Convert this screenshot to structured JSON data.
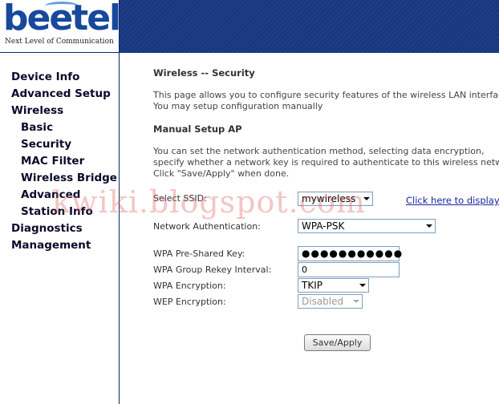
{
  "brand": {
    "logo_text": "beetel",
    "tagline": "Next Level of Communication"
  },
  "sidebar": {
    "items": [
      {
        "label": "Device Info"
      },
      {
        "label": "Advanced Setup"
      },
      {
        "label": "Wireless"
      },
      {
        "label": "Basic"
      },
      {
        "label": "Security"
      },
      {
        "label": "MAC Filter"
      },
      {
        "label": "Wireless Bridge"
      },
      {
        "label": "Advanced"
      },
      {
        "label": "Station Info"
      },
      {
        "label": "Diagnostics"
      },
      {
        "label": "Management"
      }
    ]
  },
  "main": {
    "title": "Wireless -- Security",
    "intro_line1": "This page allows you to configure security features of the wireless LAN interface.",
    "intro_line2": "You may setup configuration manually",
    "manual_heading": "Manual Setup AP",
    "desc_line1": "You can set the network authentication method, selecting data encryption,",
    "desc_line2": "specify whether a network key is required to authenticate to this wireless network",
    "desc_line3": "Click \"Save/Apply\" when done.",
    "form": {
      "ssid_label": "Select SSID:",
      "ssid_value": "mywireless",
      "auth_label": "Network Authentication:",
      "auth_value": "WPA-PSK",
      "psk_label": "WPA Pre-Shared Key:",
      "psk_value": "●●●●●●●●●●●",
      "display_link": "Click here to display",
      "rekey_label": "WPA Group Rekey Interval:",
      "rekey_value": "0",
      "encryption_label": "WPA Encryption:",
      "encryption_value": "TKIP",
      "wep_label": "WEP Encryption:",
      "wep_value": "Disabled"
    },
    "save_button": "Save/Apply"
  },
  "watermark": "kwiki.blogspot.com",
  "colors": {
    "header": "#16367e",
    "logo": "#17489b",
    "link": "#1a23a0"
  }
}
